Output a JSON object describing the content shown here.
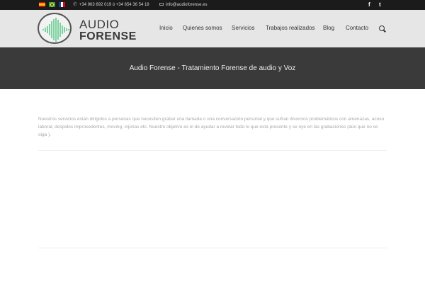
{
  "topbar": {
    "languages": [
      "Español",
      "Português",
      "Français"
    ],
    "phone": "+34 963 692 019 ó +34 654 36 54 18",
    "email": "info@audioforense.es",
    "social": {
      "facebook": "f",
      "twitter": "t"
    }
  },
  "header": {
    "logo": {
      "line1": "AUDIO",
      "line2": "FORENSE"
    },
    "nav": [
      "Inicio",
      "Quienes somos",
      "Servicios",
      "Trabajos realizados",
      "Blog",
      "Contacto"
    ],
    "icons": {
      "phone": "phone-icon",
      "email": "envelope-icon",
      "search": "search-icon"
    }
  },
  "banner": {
    "title": "Audio Forense - Tratamiento Forense de audio y Voz"
  },
  "content": {
    "paragraph": "Nuestros servicios están dirigidos a personas que necesiten grabar una llamada o una conversación personal y que sufran divorcios problemáticos con amenazas, acoso laboral, despidos improcedentes, moving, injúrias etc. Nuestro objetivo es el de ayudar a revelar todo lo que esta presente y se oye en las grabaciones (aún que no se oiga )."
  },
  "colors": {
    "topbar": "#1b1b1b",
    "header": "#e6e6e6",
    "banner": "#3a3a3a",
    "logo_wave": "#2fbf6a"
  }
}
